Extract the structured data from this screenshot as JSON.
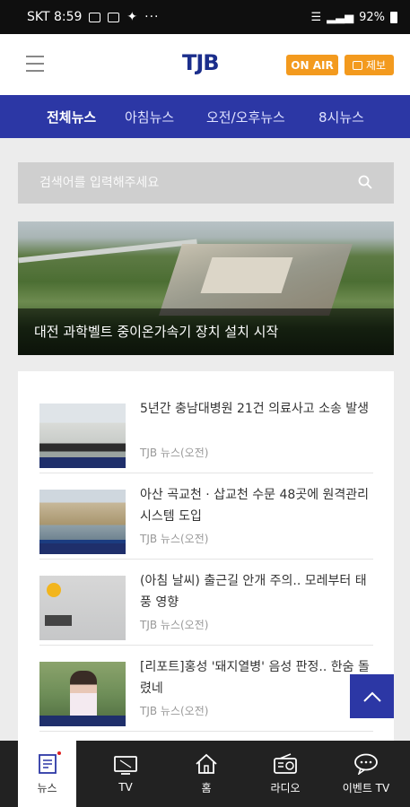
{
  "status_bar": {
    "carrier_time": "SKT 8:59",
    "battery": "92%",
    "more": "···"
  },
  "header": {
    "logo": "TJB",
    "onair_label": "ON AIR",
    "report_label": "제보"
  },
  "tabs": [
    {
      "label": "전체뉴스",
      "active": true
    },
    {
      "label": "아침뉴스",
      "active": false
    },
    {
      "label": "오전/오후뉴스",
      "active": false
    },
    {
      "label": "8시뉴스",
      "active": false
    }
  ],
  "search": {
    "placeholder": "검색어를 입력해주세요"
  },
  "hero": {
    "caption": "대전 과학벨트 중이온가속기 장치 설치 시작"
  },
  "news_items": [
    {
      "title": "5년간 충남대병원 21건 의료사고 소송 발생",
      "source": "TJB 뉴스(오전)"
    },
    {
      "title": "아산 곡교천 · 삽교천 수문 48곳에 원격관리 시스템 도입",
      "source": "TJB 뉴스(오전)"
    },
    {
      "title": "(아침 날씨) 출근길 안개 주의.. 모레부터 태풍 영향",
      "source": "TJB 뉴스(오전)"
    },
    {
      "title": "[리포트]홍성 '돼지열병' 음성 판정.. 한숨 돌렸네",
      "source": "TJB 뉴스(오전)"
    }
  ],
  "bottom_nav": [
    {
      "label": "뉴스",
      "icon": "news-icon",
      "active": true
    },
    {
      "label": "TV",
      "icon": "tv-icon",
      "active": false
    },
    {
      "label": "홈",
      "icon": "home-icon",
      "active": false
    },
    {
      "label": "라디오",
      "icon": "radio-icon",
      "active": false
    },
    {
      "label": "이벤트 TV",
      "icon": "chat-bubble-icon",
      "active": false
    }
  ],
  "colors": {
    "brand_blue": "#2c37a5",
    "accent_orange": "#f39a1e"
  }
}
